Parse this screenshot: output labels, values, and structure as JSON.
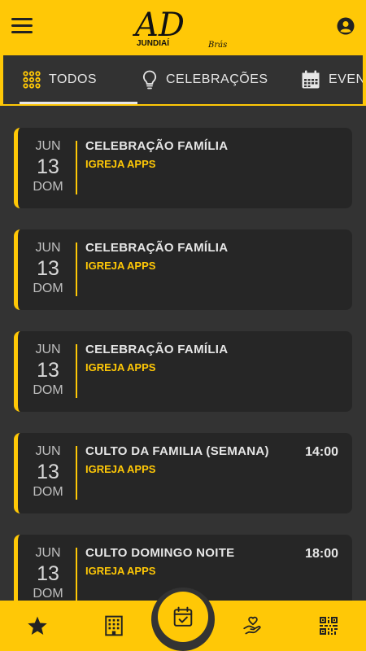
{
  "header": {
    "logo_primary": "AD",
    "logo_city": "JUNDIAÍ",
    "logo_suffix": "Brás"
  },
  "tabs": [
    {
      "label": "TODOS",
      "icon": "grid-dots-icon",
      "active": true
    },
    {
      "label": "CELEBRAÇÕES",
      "icon": "lightbulb-icon",
      "active": false
    },
    {
      "label": "EVENTOS",
      "icon": "calendar-icon",
      "active": false
    }
  ],
  "events": [
    {
      "month": "JUN",
      "day": "13",
      "weekday": "DOM",
      "title": "CELEBRAÇÃO FAMÍLIA",
      "organizer": "IGREJA APPS",
      "time": ""
    },
    {
      "month": "JUN",
      "day": "13",
      "weekday": "DOM",
      "title": "CELEBRAÇÃO FAMÍLIA",
      "organizer": "IGREJA APPS",
      "time": ""
    },
    {
      "month": "JUN",
      "day": "13",
      "weekday": "DOM",
      "title": "CELEBRAÇÃO FAMÍLIA",
      "organizer": "IGREJA APPS",
      "time": ""
    },
    {
      "month": "JUN",
      "day": "13",
      "weekday": "DOM",
      "title": "CULTO DA FAMILIA (SEMANA)",
      "organizer": "IGREJA APPS",
      "time": "14:00"
    },
    {
      "month": "JUN",
      "day": "13",
      "weekday": "DOM",
      "title": "CULTO DOMINGO NOITE",
      "organizer": "IGREJA APPS",
      "time": "18:00"
    }
  ],
  "bottom_nav": [
    {
      "icon": "star-icon"
    },
    {
      "icon": "building-icon"
    },
    {
      "icon": "calendar-check-icon",
      "active": true
    },
    {
      "icon": "hand-heart-icon"
    },
    {
      "icon": "qr-code-icon"
    }
  ],
  "colors": {
    "accent": "#FFC806",
    "background": "#333333",
    "card": "#262626",
    "text": "#E6E6E6"
  }
}
